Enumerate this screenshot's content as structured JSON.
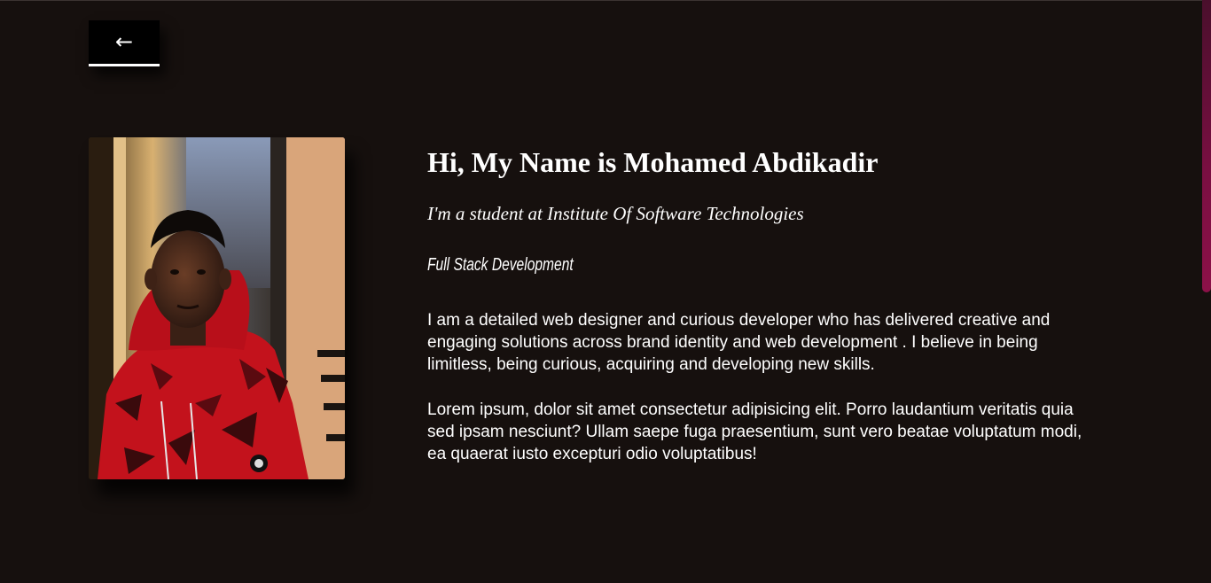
{
  "nav": {
    "back_icon": "←",
    "back_icon_name": "left-arrow-icon"
  },
  "profile": {
    "photo_alt": "Portrait photo",
    "title": "Hi, My Name is Mohamed Abdikadir",
    "subtitle": "I'm a student at Institute Of Software Technologies",
    "specialty": "Full Stack Development",
    "paragraphs": [
      "I am a detailed web designer and curious developer who has delivered creative and engaging solutions across brand identity and web development . I believe in being limitless, being curious, acquiring and developing new skills.",
      "Lorem ipsum, dolor sit amet consectetur adipisicing elit. Porro laudantium veritatis quia sed ipsam nesciunt? Ullam saepe fuga praesentium, sunt vero beatae voluptatum modi, ea quaerat iusto excepturi odio voluptatibus!"
    ]
  },
  "colors": {
    "background": "#16100e",
    "text": "#ffffff",
    "button_bg": "#000000",
    "scrollbar_thumb": "#8c1148"
  }
}
